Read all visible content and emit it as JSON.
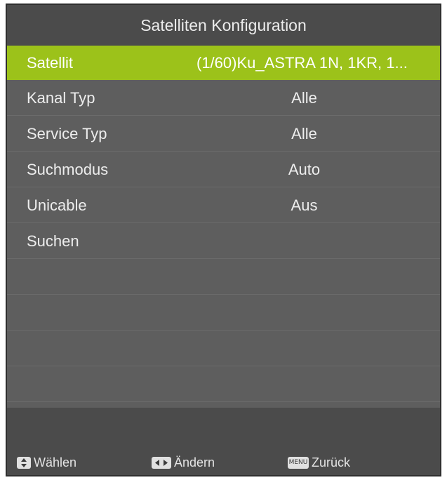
{
  "header": {
    "title": "Satelliten Konfiguration"
  },
  "menu": {
    "items": [
      {
        "label": "Satellit",
        "value": "(1/60)Ku_ASTRA 1N, 1KR, 1..."
      },
      {
        "label": "Kanal Typ",
        "value": "Alle"
      },
      {
        "label": "Service Typ",
        "value": "Alle"
      },
      {
        "label": "Suchmodus",
        "value": "Auto"
      },
      {
        "label": "Unicable",
        "value": "Aus"
      },
      {
        "label": "Suchen",
        "value": ""
      }
    ],
    "selected_index": 0,
    "highlight_color": "#9cc21a"
  },
  "footer": {
    "select": {
      "icon": "up-down-key-icon",
      "label": "Wählen"
    },
    "change": {
      "icon": "left-right-key-icon",
      "label": "Ändern"
    },
    "back": {
      "icon": "menu-key-icon",
      "key_text": "MENU",
      "label": "Zurück"
    }
  }
}
